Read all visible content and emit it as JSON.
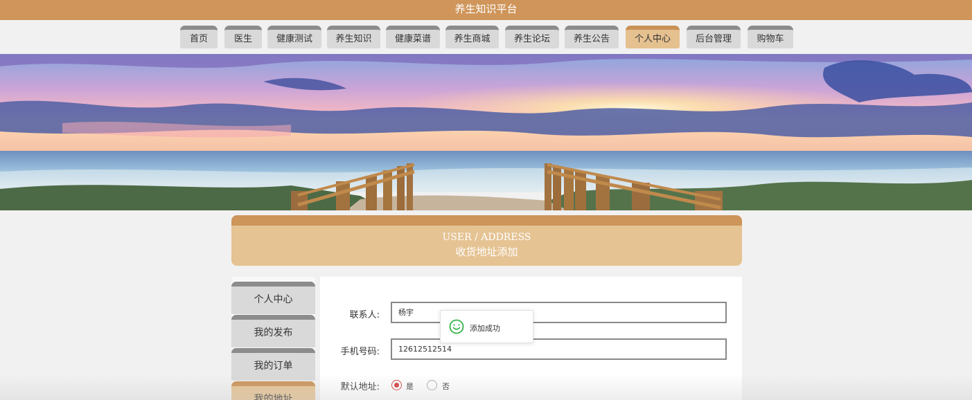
{
  "header": {
    "title": "养生知识平台"
  },
  "nav": {
    "items": [
      {
        "label": "首页"
      },
      {
        "label": "医生"
      },
      {
        "label": "健康测试"
      },
      {
        "label": "养生知识"
      },
      {
        "label": "健康菜谱"
      },
      {
        "label": "养生商城"
      },
      {
        "label": "养生论坛"
      },
      {
        "label": "养生公告"
      },
      {
        "label": "个人中心"
      },
      {
        "label": "后台管理"
      },
      {
        "label": "购物车"
      }
    ],
    "active": "个人中心"
  },
  "section": {
    "en_title": "USER / ADDRESS",
    "cn_title": "收货地址添加"
  },
  "side_menu": {
    "items": [
      {
        "label": "个人中心"
      },
      {
        "label": "我的发布"
      },
      {
        "label": "我的订单"
      },
      {
        "label": "我的地址"
      }
    ],
    "active": "我的地址"
  },
  "form": {
    "contact_label": "联系人:",
    "contact_value": "杨宇",
    "phone_label": "手机号码:",
    "phone_value": "12612512514",
    "default_label": "默认地址:",
    "default_options": [
      {
        "label": "是",
        "checked": true
      },
      {
        "label": "否",
        "checked": false
      }
    ]
  },
  "toast": {
    "message": "添加成功",
    "icon": "smile-icon"
  },
  "colors": {
    "brand": "#cf955a",
    "accent_light": "#e5c393",
    "radio_checked": "#d23a3a",
    "toast_icon": "#35b34a"
  }
}
